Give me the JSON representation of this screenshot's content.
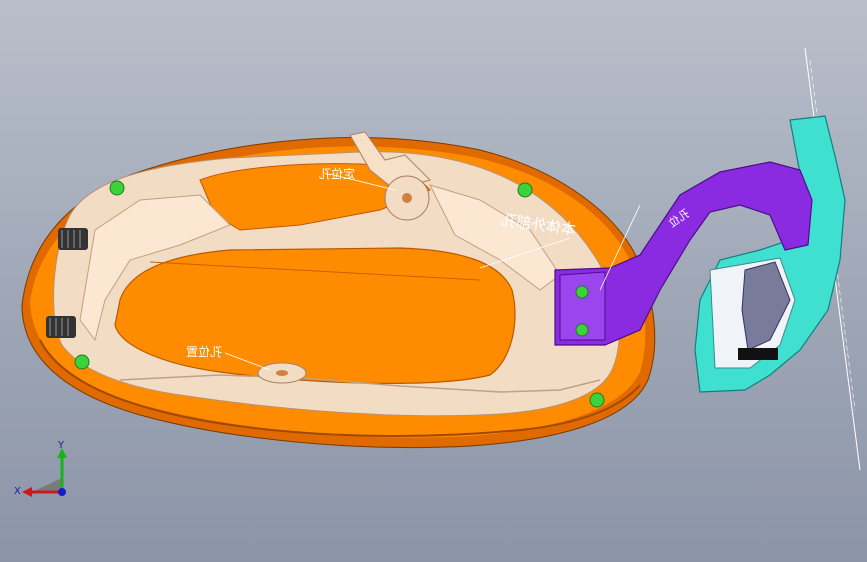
{
  "colors": {
    "background_top": "#b9bfca",
    "background_bottom": "#8c95a8",
    "cover_orange": "#ff8c00",
    "cover_dark_orange": "#e06a00",
    "frame_beige": "#f3dcc4",
    "bracket_purple": "#8a2be2",
    "latch_cyan": "#40e0d0",
    "locator_green": "#3cd23c",
    "spring_dark": "#333333"
  },
  "annotations": {
    "top_locator": "定位孔",
    "bottom_locator": "孔位置",
    "bracket_hole": "孔位",
    "part_note": "本体外部孔"
  },
  "triad": {
    "x_label": "X",
    "y_label": "Y"
  },
  "icons": {
    "triad": "coordinate-triad-icon"
  }
}
